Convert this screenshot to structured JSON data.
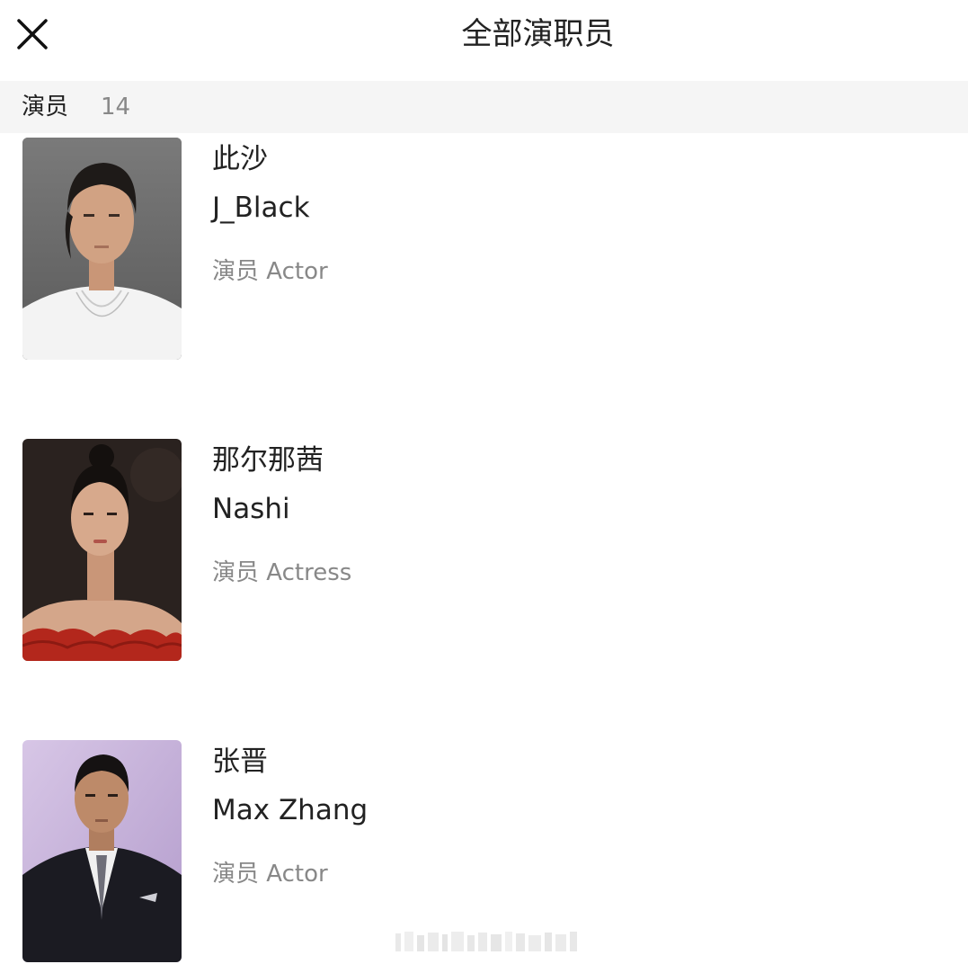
{
  "header": {
    "title": "全部演职员",
    "close_icon": "close-icon"
  },
  "section": {
    "label": "演员",
    "count": "14"
  },
  "cast": [
    {
      "name_cn": "此沙",
      "name_en": "J_Black",
      "role": "演员 Actor",
      "portrait_bg": "#6a6a6a",
      "portrait_fg": "#f2f2f2"
    },
    {
      "name_cn": "那尔那茜",
      "name_en": "Nashi",
      "role": "演员 Actress",
      "portrait_bg": "#2b2421",
      "portrait_fg": "#b8261c"
    },
    {
      "name_cn": "张晋",
      "name_en": "Max Zhang",
      "role": "演员 Actor",
      "portrait_bg": "#c9b8d9",
      "portrait_fg": "#1c1c22"
    }
  ]
}
